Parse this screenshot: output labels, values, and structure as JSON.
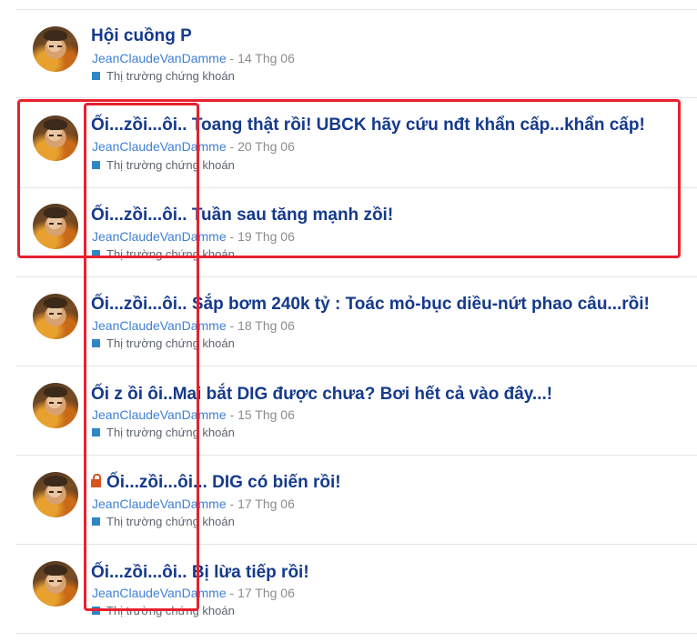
{
  "threads": [
    {
      "title": "Hội cuồng P",
      "author": "JeanClaudeVanDamme",
      "date": "14 Thg 06",
      "forum": "Thị trường chứng khoán",
      "locked": false
    },
    {
      "title": "Ối...zồi...ôi..  Toang thật rồi! UBCK hãy cứu nđt khẩn cấp...khẩn cấp!",
      "author": "JeanClaudeVanDamme",
      "date": "20 Thg 06",
      "forum": "Thị trường chứng khoán",
      "locked": false
    },
    {
      "title": "Ối...zồi...ôi.. Tuần sau tăng mạnh zồi!",
      "author": "JeanClaudeVanDamme",
      "date": "19 Thg 06",
      "forum": "Thị trường chứng khoán",
      "locked": false
    },
    {
      "title": "Ối...zồi...ôi..  Sắp bơm 240k tỷ : Toác mỏ-bục diều-nứt phao câu...rồi!",
      "author": "JeanClaudeVanDamme",
      "date": "18 Thg 06",
      "forum": "Thị trường chứng khoán",
      "locked": false
    },
    {
      "title": "Ối z ồi ôi..Mai bắt DIG được chưa? Bơi hết cả vào đây...!",
      "author": "JeanClaudeVanDamme",
      "date": "15 Thg 06",
      "forum": "Thị trường chứng khoán",
      "locked": false
    },
    {
      "title": "Ối...zồi...ôi... DIG có biến rồi!",
      "author": "JeanClaudeVanDamme",
      "date": "17 Thg 06",
      "forum": "Thị trường chứng khoán",
      "locked": true
    },
    {
      "title": "Ối...zồi...ôi.. Bị lừa tiếp rồi!",
      "author": "JeanClaudeVanDamme",
      "date": "17 Thg 06",
      "forum": "Thị trường chứng khoán",
      "locked": false
    }
  ],
  "separator": " - ",
  "colors": {
    "title": "#153a8c",
    "author": "#3f7fd6",
    "date": "#8c8c8c",
    "forum_marker": "#2f86c7",
    "lock_icon": "#d9531e",
    "highlight": "#e8212e"
  }
}
